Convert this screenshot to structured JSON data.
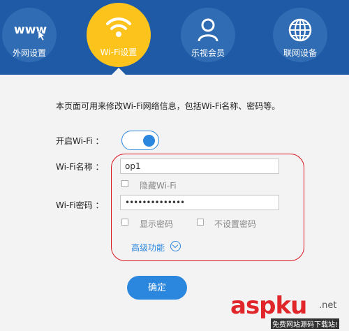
{
  "nav": {
    "items": [
      {
        "label": "外网设置",
        "icon": "www-icon"
      },
      {
        "label": "Wi-Fi设置",
        "icon": "wifi-icon"
      },
      {
        "label": "乐视会员",
        "icon": "user-icon"
      },
      {
        "label": "联网设备",
        "icon": "globe-icon"
      }
    ],
    "www_text": "www"
  },
  "form": {
    "description": "本页面可用来修改Wi-Fi网络信息，包括Wi-Fi名称、密码等。",
    "enable_wifi_label": "开启Wi-Fi ：",
    "enable_wifi_on": true,
    "ssid_label": "Wi-Fi名称 ：",
    "ssid_value": "op1",
    "hide_ssid_label": "隐藏Wi-Fi",
    "password_label": "Wi-Fi密码 ：",
    "password_value": "••••••••••••••",
    "show_password_label": "显示密码",
    "no_password_label": "不设置密码",
    "advanced_label": "高级功能",
    "confirm_label": "确定"
  },
  "colors": {
    "header_bg": "#1e5aa5",
    "active_tab": "#fcc31d",
    "accent": "#2b86de",
    "highlight": "#d8151e"
  },
  "watermark": {
    "brand": "aspku",
    "net": ".net",
    "sub": "免费网站源码下载站!"
  }
}
